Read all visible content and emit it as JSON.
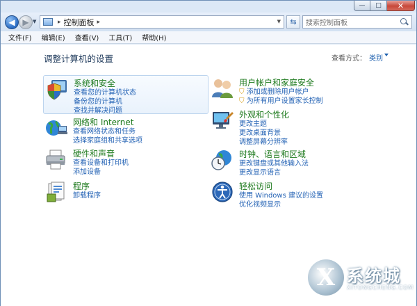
{
  "window": {
    "caption": {
      "minimize": "—",
      "maximize": "□",
      "close": "✕"
    }
  },
  "nav": {
    "back_icon": "arrow-left",
    "forward_icon": "arrow-right",
    "address_path": "控制面板",
    "address_sep": "▸",
    "refresh_icon": "refresh",
    "search_placeholder": "搜索控制面板"
  },
  "menu": [
    "文件(F)",
    "编辑(E)",
    "查看(V)",
    "工具(T)",
    "帮助(H)"
  ],
  "page": {
    "title": "调整计算机的设置",
    "view_by_label": "查看方式：",
    "view_by_value": "类别"
  },
  "categories": [
    {
      "title": "系统和安全",
      "icon": "shield-pc-icon",
      "links": [
        "查看您的计算机状态",
        "备份您的计算机",
        "查找并解决问题"
      ]
    },
    {
      "title": "网络和 Internet",
      "icon": "globe-network-icon",
      "links": [
        "查看网络状态和任务",
        "选择家庭组和共享选项"
      ]
    },
    {
      "title": "硬件和声音",
      "icon": "printer-icon",
      "links": [
        "查看设备和打印机",
        "添加设备"
      ]
    },
    {
      "title": "程序",
      "icon": "programs-icon",
      "links": [
        "卸载程序"
      ]
    },
    {
      "title": "用户帐户和家庭安全",
      "icon": "users-icon",
      "links": [
        "添加或删除用户帐户",
        "为所有用户设置家长控制"
      ]
    },
    {
      "title": "外观和个性化",
      "icon": "monitor-paint-icon",
      "links": [
        "更改主题",
        "更改桌面背景",
        "调整屏幕分辨率"
      ]
    },
    {
      "title": "时钟、语言和区域",
      "icon": "clock-globe-icon",
      "links": [
        "更改键盘或其他输入法",
        "更改显示语言"
      ]
    },
    {
      "title": "轻松访问",
      "icon": "ease-of-access-icon",
      "links": [
        "使用 Windows 建议的设置",
        "优化视频显示"
      ]
    }
  ],
  "watermark": {
    "mark": "X",
    "brand": "系统城",
    "url": "XITONGCHENG.COM"
  }
}
